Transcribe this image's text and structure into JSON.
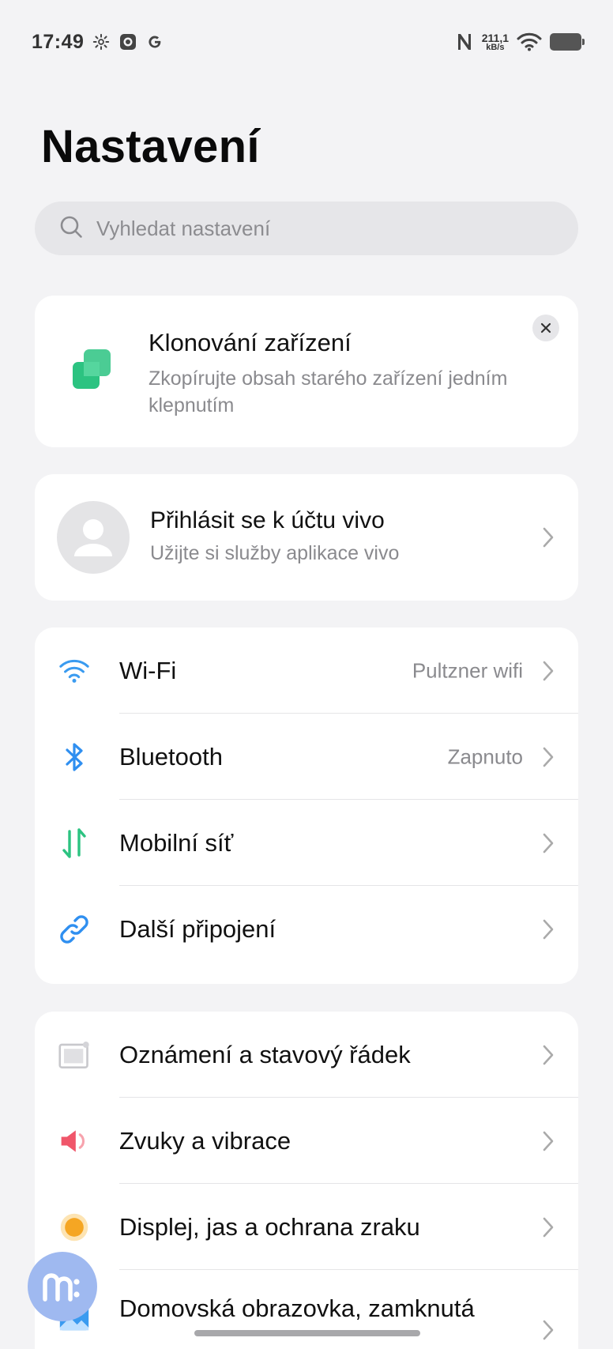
{
  "status_bar": {
    "time": "17:49",
    "left_icons": [
      "settings-gear-icon",
      "camera-icon",
      "google-icon"
    ],
    "nfc_icon": "nfc-icon",
    "speed_value": "211,1",
    "speed_unit": "kB/s",
    "wifi_icon": "wifi-icon",
    "battery_icon": "battery-icon"
  },
  "header": {
    "title": "Nastavení"
  },
  "search": {
    "placeholder": "Vyhledat nastavení",
    "icon": "search-icon"
  },
  "clone_card": {
    "title": "Klonování zařízení",
    "subtitle": "Zkopírujte obsah starého zařízení jedním klepnutím",
    "icon": "device-clone-icon",
    "accent": "#2cc381"
  },
  "account_card": {
    "title": "Přihlásit se k účtu vivo",
    "subtitle": "Užijte si služby aplikace vivo"
  },
  "connectivity": [
    {
      "label": "Wi-Fi",
      "value": "Pultzner wifi",
      "icon": "wifi-icon",
      "color": "#3a9bf0"
    },
    {
      "label": "Bluetooth",
      "value": "Zapnuto",
      "icon": "bluetooth-icon",
      "color": "#2f8ff0"
    },
    {
      "label": "Mobilní síť",
      "value": "",
      "icon": "mobile-data-icon",
      "color": "#2cc381"
    },
    {
      "label": "Další připojení",
      "value": "",
      "icon": "link-icon",
      "color": "#2f8ff0"
    }
  ],
  "display_group": [
    {
      "label": "Oznámení a stavový řádek",
      "icon": "notification-icon"
    },
    {
      "label": "Zvuky a vibrace",
      "icon": "speaker-icon",
      "color": "#f0566a"
    },
    {
      "label": "Displej, jas a ochrana zraku",
      "icon": "brightness-icon",
      "color": "#f5a623"
    },
    {
      "label": "Domovská obrazovka, zamknutá",
      "icon": "wallpaper-icon",
      "color": "#3a9bf0"
    }
  ]
}
